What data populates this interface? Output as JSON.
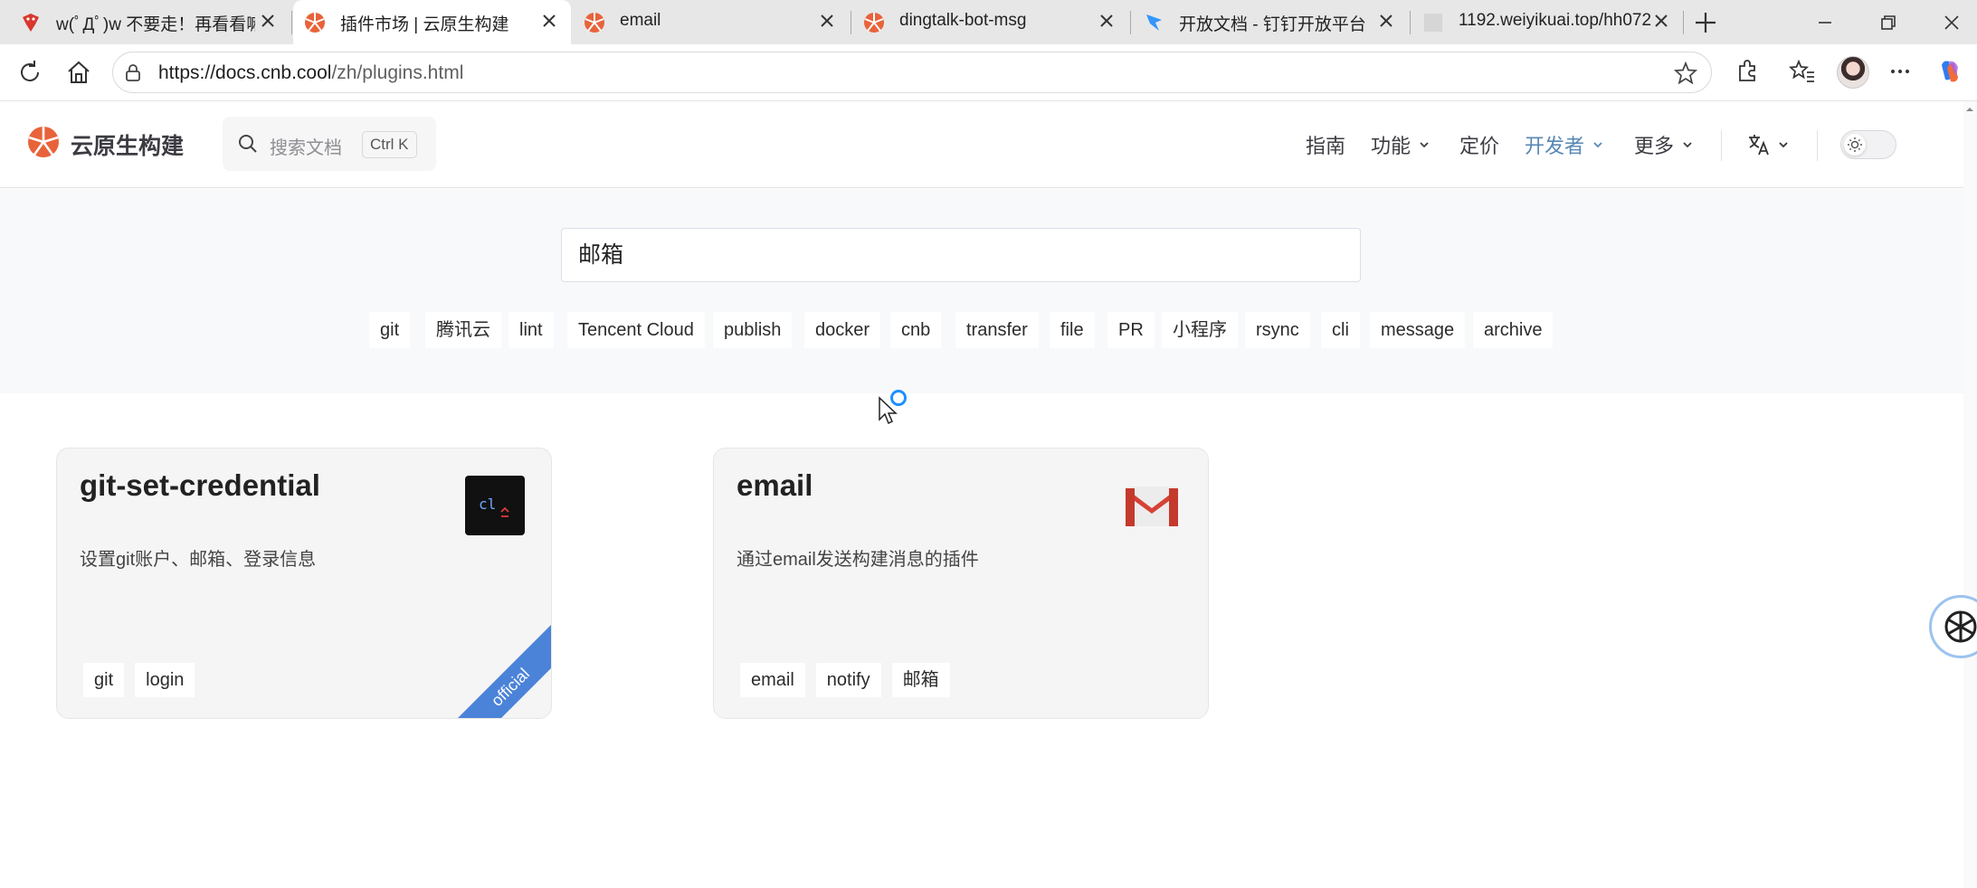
{
  "browser": {
    "tabs": [
      {
        "title": "w(ﾟДﾟ)w 不要走！再看看嘛",
        "favicon": "red-bird-icon",
        "active": false
      },
      {
        "title": "插件市场 | 云原生构建",
        "favicon": "cnb-logo-icon",
        "active": true
      },
      {
        "title": "email",
        "favicon": "cnb-logo-icon",
        "active": false
      },
      {
        "title": "dingtalk-bot-msg",
        "favicon": "cnb-logo-icon",
        "active": false
      },
      {
        "title": "开放文档 - 钉钉开放平台",
        "favicon": "dingtalk-icon",
        "active": false
      },
      {
        "title": "1192.weiyikuai.top/hh072",
        "favicon": "blank-page-icon",
        "active": false
      }
    ],
    "url_host": "https://docs.cnb.cool",
    "url_path": "/zh/plugins.html"
  },
  "site": {
    "brand": "云原生构建",
    "search_placeholder": "搜索文档",
    "search_shortcut": "Ctrl K",
    "nav": [
      {
        "label": "指南",
        "dropdown": false,
        "active": false
      },
      {
        "label": "功能",
        "dropdown": true,
        "active": false
      },
      {
        "label": "定价",
        "dropdown": false,
        "active": false
      },
      {
        "label": "开发者",
        "dropdown": true,
        "active": true
      },
      {
        "label": "更多",
        "dropdown": true,
        "active": false
      }
    ],
    "accent_color": "#5787b5"
  },
  "plugin_search": {
    "query": "邮箱",
    "tags": [
      "git",
      "腾讯云",
      "lint",
      "Tencent Cloud",
      "publish",
      "docker",
      "cnb",
      "transfer",
      "file",
      "PR",
      "小程序",
      "rsync",
      "cli",
      "message",
      "archive"
    ]
  },
  "plugins": [
    {
      "name": "git-set-credential",
      "description": "设置git账户、邮箱、登录信息",
      "tags": [
        "git",
        "login"
      ],
      "icon": "terminal-cli-icon",
      "icon_text": "cl",
      "badge": "official"
    },
    {
      "name": "email",
      "description": "通过email发送构建消息的插件",
      "tags": [
        "email",
        "notify",
        "邮箱"
      ],
      "icon": "gmail-icon"
    }
  ]
}
